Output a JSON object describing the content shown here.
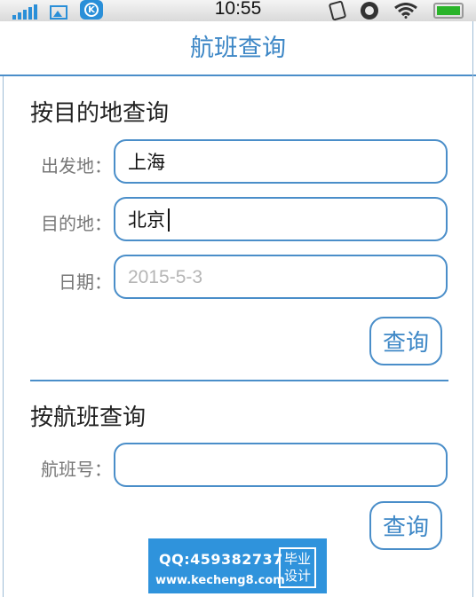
{
  "status_bar": {
    "time": "10:55",
    "left_icons": [
      "signal-icon",
      "image-icon",
      "k-app-icon"
    ],
    "right_icons": [
      "vibrate-icon",
      "alarm-icon",
      "wifi-icon",
      "battery-icon"
    ],
    "k_app_letter": "K"
  },
  "header": {
    "title": "航班查询"
  },
  "by_destination": {
    "title": "按目的地查询",
    "departure_label": "出发地：",
    "departure_value": "上海",
    "destination_label": "目的地：",
    "destination_value": "北京",
    "date_label": "日期：",
    "date_placeholder": "2015-5-3",
    "query_label": "查询"
  },
  "by_flight": {
    "title": "按航班查询",
    "flight_label": "航班号：",
    "flight_value": "",
    "query_label": "查询"
  },
  "watermark": {
    "qq": "QQ:459382737",
    "url": "www.kecheng8.com",
    "tag_line1": "毕业",
    "tag_line2": "设计"
  },
  "colors": {
    "accent": "#4a8ec9",
    "title": "#3d87c6",
    "watermark_bg": "#2f93dc"
  }
}
